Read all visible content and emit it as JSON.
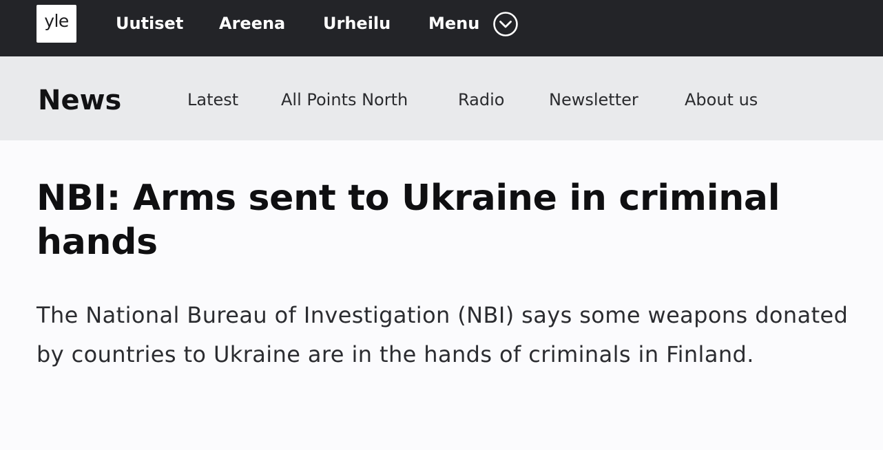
{
  "topbar": {
    "logo_text": "yle",
    "nav": [
      "Uutiset",
      "Areena",
      "Urheilu"
    ],
    "menu_label": "Menu",
    "menu_icon": "chevron-down-circle-icon",
    "background": "#232428"
  },
  "subbar": {
    "section_title": "News",
    "nav": [
      "Latest",
      "All Points North",
      "Radio",
      "Newsletter",
      "About us"
    ],
    "background": "#e9eaec"
  },
  "article": {
    "headline": "NBI: Arms sent to Ukraine in criminal hands",
    "lead": "The National Bureau of Investigation (NBI) says some weapons donated by countries to Ukraine are in the hands of criminals in Finland."
  }
}
